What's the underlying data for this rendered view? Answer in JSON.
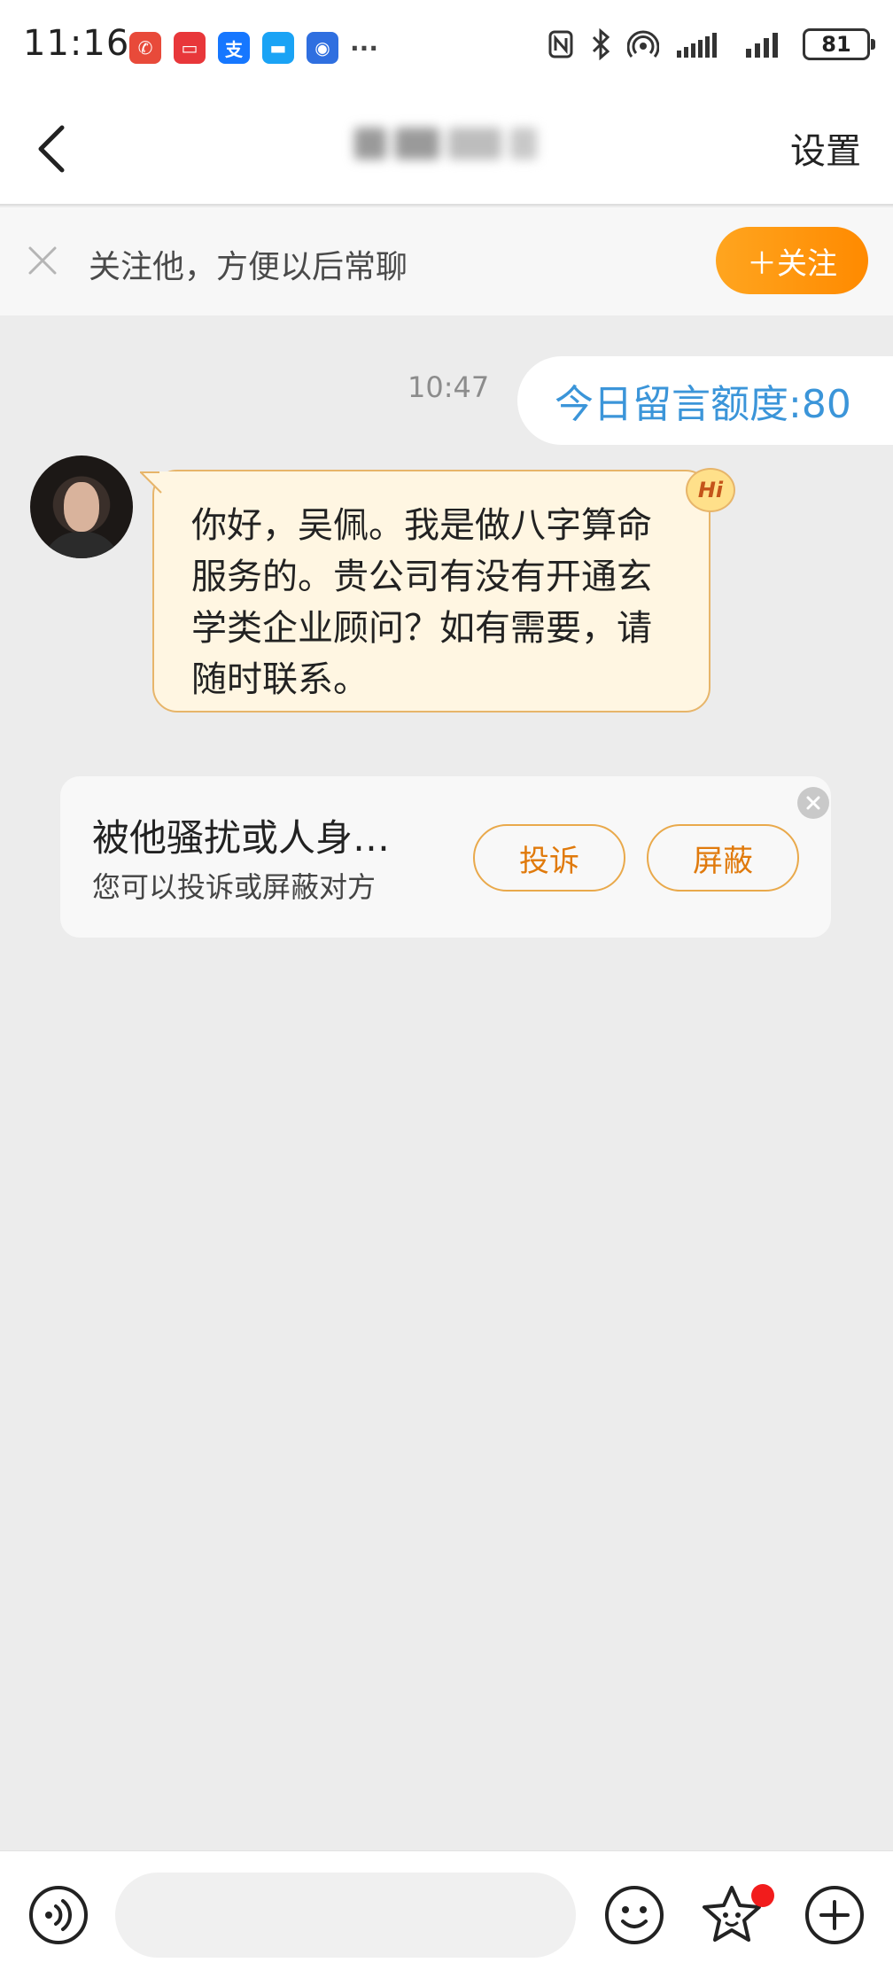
{
  "status_bar": {
    "time": "11:16",
    "notifications": [
      {
        "name": "missed-call-icon",
        "color": "#e84a3a",
        "glyph": "✆"
      },
      {
        "name": "huawei-icon",
        "color": "#e8373a",
        "glyph": "▭"
      },
      {
        "name": "alipay-icon",
        "color": "#1677ff",
        "glyph": "支"
      },
      {
        "name": "message-icon",
        "color": "#1aa3f5",
        "glyph": "▬"
      },
      {
        "name": "app-icon",
        "color": "#2f6fe0",
        "glyph": "◉"
      }
    ],
    "more": "···",
    "battery": "81"
  },
  "nav": {
    "settings_label": "设置"
  },
  "follow_banner": {
    "text": "关注他，方便以后常聊",
    "button_label": "＋关注"
  },
  "chat": {
    "timestamp": "10:47",
    "quota_text": "今日留言额度:80",
    "message_text": "你好，吴佩。我是做八字算命服务的。贵公司有没有开通玄学类企业顾问？如有需要，请随时联系。",
    "hi_badge": "Hi"
  },
  "harass_card": {
    "title": "被他骚扰或人身…",
    "subtitle": "您可以投诉或屏蔽对方",
    "report_label": "投诉",
    "block_label": "屏蔽"
  },
  "bottom_bar": {
    "input_value": ""
  },
  "colors": {
    "accent_orange": "#ff8a00",
    "quota_blue": "#3b95d9",
    "bubble_bg": "#fff6e2",
    "chat_bg": "#ececec"
  }
}
